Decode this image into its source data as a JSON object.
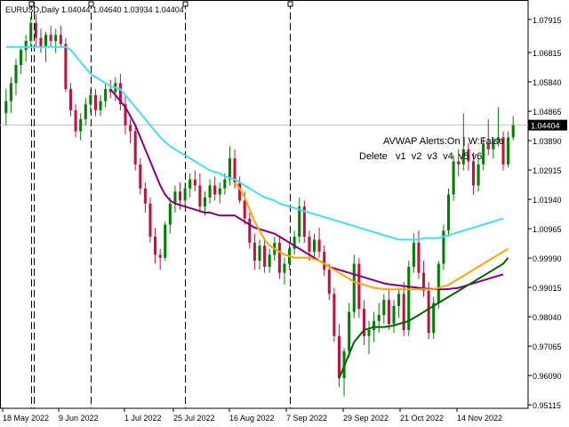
{
  "header": {
    "symbol": "EURUSD,Daily",
    "open": "1.04044",
    "high": "1.04640",
    "low": "1.03934",
    "close": "1.04404"
  },
  "indicator_panel": {
    "alerts_label": "AVWAP Alerts:On | W:False",
    "delete_label": "Delete",
    "buttons": [
      "v1",
      "v2",
      "v3",
      "v4",
      "v5",
      "v6"
    ]
  },
  "price_label": "1.04404",
  "colors": {
    "bull": "#008000",
    "bear": "#c0143c",
    "vwap_cyan": "#40e0f0",
    "vwap_purple": "#800080",
    "vwap_orange": "#ffa500",
    "vwap_green": "#006400",
    "grid_line": "#c0c0c0",
    "price_box": "#000000"
  },
  "chart_data": {
    "type": "candlestick",
    "symbol": "EURUSD",
    "timeframe": "Daily",
    "ylim": [
      0.95,
      1.085
    ],
    "y_ticks": [
      "1.07915",
      "1.06815",
      "1.05840",
      "1.04865",
      "1.03890",
      "1.02915",
      "1.01940",
      "1.00965",
      "0.99990",
      "0.99015",
      "0.98040",
      "0.97065",
      "0.96090",
      "0.95115"
    ],
    "x_ticks": [
      "18 May 2022",
      "9 Jun 2022",
      "1 Jul 2022",
      "25 Jul 2022",
      "16 Aug 2022",
      "7 Sep 2022",
      "29 Sep 2022",
      "21 Oct 2022",
      "14 Nov 2022"
    ],
    "current_price": 1.04404,
    "candles": [
      [
        1.048,
        1.056,
        1.044,
        1.052
      ],
      [
        1.052,
        1.06,
        1.048,
        1.058
      ],
      [
        1.058,
        1.066,
        1.054,
        1.064
      ],
      [
        1.064,
        1.07,
        1.061,
        1.069
      ],
      [
        1.069,
        1.074,
        1.065,
        1.072
      ],
      [
        1.072,
        1.08,
        1.07,
        1.078
      ],
      [
        1.078,
        1.081,
        1.07,
        1.073
      ],
      [
        1.073,
        1.076,
        1.068,
        1.07
      ],
      [
        1.07,
        1.075,
        1.065,
        1.074
      ],
      [
        1.074,
        1.077,
        1.07,
        1.072
      ],
      [
        1.072,
        1.076,
        1.068,
        1.074
      ],
      [
        1.074,
        1.077,
        1.07,
        1.071
      ],
      [
        1.071,
        1.073,
        1.055,
        1.056
      ],
      [
        1.056,
        1.058,
        1.047,
        1.049
      ],
      [
        1.049,
        1.051,
        1.04,
        1.042
      ],
      [
        1.042,
        1.048,
        1.039,
        1.046
      ],
      [
        1.046,
        1.053,
        1.044,
        1.051
      ],
      [
        1.051,
        1.056,
        1.048,
        1.054
      ],
      [
        1.054,
        1.056,
        1.047,
        1.049
      ],
      [
        1.049,
        1.054,
        1.047,
        1.052
      ],
      [
        1.052,
        1.058,
        1.05,
        1.056
      ],
      [
        1.056,
        1.059,
        1.053,
        1.055
      ],
      [
        1.055,
        1.06,
        1.052,
        1.058
      ],
      [
        1.058,
        1.061,
        1.049,
        1.051
      ],
      [
        1.051,
        1.054,
        1.041,
        1.044
      ],
      [
        1.044,
        1.046,
        1.038,
        1.042
      ],
      [
        1.042,
        1.044,
        1.029,
        1.031
      ],
      [
        1.031,
        1.033,
        1.021,
        1.023
      ],
      [
        1.023,
        1.025,
        1.015,
        1.018
      ],
      [
        1.018,
        1.02,
        1.005,
        1.007
      ],
      [
        1.007,
        1.01,
        0.998,
        1.001
      ],
      [
        1.001,
        1.003,
        0.996,
        1.0
      ],
      [
        1.0,
        1.012,
        0.999,
        1.011
      ],
      [
        1.011,
        1.02,
        1.008,
        1.018
      ],
      [
        1.018,
        1.024,
        1.015,
        1.022
      ],
      [
        1.022,
        1.025,
        1.016,
        1.019
      ],
      [
        1.019,
        1.025,
        1.017,
        1.023
      ],
      [
        1.023,
        1.028,
        1.02,
        1.026
      ],
      [
        1.026,
        1.029,
        1.022,
        1.024
      ],
      [
        1.024,
        1.028,
        1.015,
        1.017
      ],
      [
        1.017,
        1.022,
        1.014,
        1.02
      ],
      [
        1.02,
        1.026,
        1.018,
        1.024
      ],
      [
        1.024,
        1.027,
        1.019,
        1.021
      ],
      [
        1.021,
        1.025,
        1.018,
        1.023
      ],
      [
        1.023,
        1.028,
        1.021,
        1.026
      ],
      [
        1.026,
        1.037,
        1.024,
        1.033
      ],
      [
        1.033,
        1.036,
        1.023,
        1.025
      ],
      [
        1.025,
        1.027,
        1.018,
        1.019
      ],
      [
        1.019,
        1.022,
        1.011,
        1.013
      ],
      [
        1.013,
        1.015,
        1.003,
        1.005
      ],
      [
        1.005,
        1.008,
        0.996,
        0.999
      ],
      [
        0.999,
        1.006,
        0.996,
        1.004
      ],
      [
        1.004,
        1.006,
        0.995,
        0.997
      ],
      [
        0.997,
        1.003,
        0.995,
        1.001
      ],
      [
        1.001,
        1.007,
        0.999,
        1.005
      ],
      [
        1.005,
        1.007,
        0.993,
        0.995
      ],
      [
        0.995,
        1.0,
        0.991,
        0.998
      ],
      [
        0.998,
        1.005,
        0.996,
        1.003
      ],
      [
        1.003,
        1.009,
        1.001,
        1.007
      ],
      [
        1.007,
        1.02,
        1.005,
        1.017
      ],
      [
        1.017,
        1.019,
        1.005,
        1.007
      ],
      [
        1.007,
        1.009,
        0.999,
        1.002
      ],
      [
        1.002,
        1.008,
        1.0,
        1.006
      ],
      [
        1.006,
        1.01,
        1.0,
        1.002
      ],
      [
        1.002,
        1.004,
        0.994,
        0.996
      ],
      [
        0.996,
        0.998,
        0.986,
        0.988
      ],
      [
        0.988,
        0.99,
        0.972,
        0.974
      ],
      [
        0.974,
        0.978,
        0.957,
        0.96
      ],
      [
        0.96,
        0.97,
        0.954,
        0.969
      ],
      [
        0.969,
        0.985,
        0.967,
        0.982
      ],
      [
        0.982,
        1.001,
        0.98,
        0.998
      ],
      [
        0.998,
        1.0,
        0.98,
        0.983
      ],
      [
        0.983,
        0.986,
        0.971,
        0.974
      ],
      [
        0.974,
        0.979,
        0.968,
        0.976
      ],
      [
        0.976,
        0.982,
        0.972,
        0.979
      ],
      [
        0.979,
        0.985,
        0.975,
        0.981
      ],
      [
        0.981,
        0.988,
        0.978,
        0.986
      ],
      [
        0.986,
        0.99,
        0.976,
        0.978
      ],
      [
        0.978,
        0.986,
        0.975,
        0.984
      ],
      [
        0.984,
        0.99,
        0.98,
        0.988
      ],
      [
        0.988,
        0.992,
        0.974,
        0.976
      ],
      [
        0.976,
        0.999,
        0.974,
        0.997
      ],
      [
        0.997,
        1.008,
        0.995,
        1.005
      ],
      [
        1.005,
        1.009,
        0.993,
        0.995
      ],
      [
        0.995,
        0.999,
        0.987,
        0.989
      ],
      [
        0.989,
        0.992,
        0.973,
        0.975
      ],
      [
        0.975,
        0.987,
        0.973,
        0.985
      ],
      [
        0.985,
        0.999,
        0.983,
        0.998
      ],
      [
        0.998,
        1.011,
        0.996,
        1.009
      ],
      [
        1.009,
        1.023,
        1.007,
        1.021
      ],
      [
        1.021,
        1.034,
        1.019,
        1.032
      ],
      [
        1.032,
        1.036,
        1.027,
        1.031
      ],
      [
        1.031,
        1.048,
        1.029,
        1.036
      ],
      [
        1.036,
        1.038,
        1.029,
        1.032
      ],
      [
        1.032,
        1.035,
        1.021,
        1.024
      ],
      [
        1.024,
        1.033,
        1.022,
        1.031
      ],
      [
        1.031,
        1.04,
        1.029,
        1.038
      ],
      [
        1.038,
        1.046,
        1.034,
        1.036
      ],
      [
        1.036,
        1.04,
        1.033,
        1.039
      ],
      [
        1.039,
        1.05,
        1.037,
        1.04
      ],
      [
        1.04,
        1.042,
        1.029,
        1.031
      ],
      [
        1.031,
        1.042,
        1.03,
        1.04
      ],
      [
        1.04,
        1.047,
        1.039,
        1.044
      ]
    ],
    "vwap_lines": [
      {
        "color": "cyan",
        "anchor_index": 0,
        "values": [
          1.07,
          1.07,
          1.07,
          1.07,
          1.07,
          1.07,
          1.07,
          1.07,
          1.07,
          1.07,
          1.07,
          1.07,
          1.07,
          1.069,
          1.067,
          1.065,
          1.063,
          1.061,
          1.06,
          1.059,
          1.058,
          1.057,
          1.0565,
          1.056,
          1.054,
          1.052,
          1.05,
          1.048,
          1.046,
          1.044,
          1.042,
          1.04,
          1.0385,
          1.037,
          1.036,
          1.035,
          1.034,
          1.033,
          1.032,
          1.031,
          1.03,
          1.029,
          1.0285,
          1.028,
          1.027,
          1.0265,
          1.026,
          1.025,
          1.024,
          1.023,
          1.022,
          1.021,
          1.02,
          1.0195,
          1.019,
          1.018,
          1.0175,
          1.017,
          1.0165,
          1.016,
          1.0155,
          1.015,
          1.0145,
          1.014,
          1.0135,
          1.013,
          1.0125,
          1.012,
          1.0115,
          1.011,
          1.0105,
          1.01,
          1.0095,
          1.009,
          1.0085,
          1.008,
          1.0075,
          1.007,
          1.0065,
          1.006,
          1.006,
          1.006,
          1.006,
          1.006,
          1.0065,
          1.0065,
          1.0065,
          1.0065,
          1.007,
          1.0075,
          1.008,
          1.0085,
          1.009,
          1.0095,
          1.01,
          1.0105,
          1.011,
          1.0115,
          1.012,
          1.0125,
          1.013
        ]
      },
      {
        "color": "purple",
        "anchor_index": 21,
        "values": [
          1.056,
          1.054,
          1.052,
          1.05,
          1.047,
          1.044,
          1.04,
          1.036,
          1.032,
          1.028,
          1.024,
          1.021,
          1.019,
          1.018,
          1.0175,
          1.017,
          1.0165,
          1.016,
          1.0155,
          1.015,
          1.015,
          1.0145,
          1.014,
          1.014,
          1.014,
          1.014,
          1.013,
          1.012,
          1.011,
          1.01,
          1.0095,
          1.009,
          1.0085,
          1.008,
          1.007,
          1.006,
          1.005,
          1.004,
          1.003,
          1.002,
          1.001,
          1.0,
          0.999,
          0.998,
          0.997,
          0.9965,
          0.996,
          0.9955,
          0.995,
          0.9945,
          0.994,
          0.9935,
          0.993,
          0.9925,
          0.992,
          0.9915,
          0.9912,
          0.991,
          0.9908,
          0.9906,
          0.9904,
          0.9902,
          0.99,
          0.9898,
          0.9897,
          0.9896,
          0.9895,
          0.9895,
          0.9896,
          0.9898,
          0.99,
          0.9905,
          0.991,
          0.9915,
          0.992,
          0.9925,
          0.993,
          0.9935,
          0.994,
          0.9945
        ]
      },
      {
        "color": "orange",
        "anchor_index": 46,
        "values": [
          1.025,
          1.023,
          1.02,
          1.016,
          1.012,
          1.009,
          1.006,
          1.004,
          1.003,
          1.002,
          1.001,
          1.0005,
          1.0,
          1.0,
          1.0,
          1.0,
          0.9995,
          0.999,
          0.998,
          0.997,
          0.996,
          0.995,
          0.994,
          0.993,
          0.992,
          0.9915,
          0.991,
          0.9905,
          0.99,
          0.9898,
          0.9896,
          0.9895,
          0.9895,
          0.9895,
          0.9895,
          0.9895,
          0.9895,
          0.9895,
          0.9895,
          0.9895,
          0.9895,
          0.99,
          0.9905,
          0.991,
          0.992,
          0.993,
          0.994,
          0.995,
          0.996,
          0.997,
          0.998,
          0.999,
          1.0,
          1.001,
          1.002,
          1.003
        ]
      },
      {
        "color": "green",
        "anchor_index": 67,
        "values": [
          0.96,
          0.964,
          0.968,
          0.972,
          0.974,
          0.976,
          0.9765,
          0.977,
          0.977,
          0.977,
          0.9772,
          0.9775,
          0.978,
          0.9785,
          0.979,
          0.98,
          0.981,
          0.982,
          0.983,
          0.984,
          0.985,
          0.986,
          0.987,
          0.988,
          0.989,
          0.99,
          0.991,
          0.992,
          0.993,
          0.994,
          0.995,
          0.996,
          0.997,
          0.998,
          1.0
        ]
      }
    ],
    "vertical_markers": [
      5,
      17,
      36,
      57
    ],
    "marker_labels_hidden": true
  }
}
